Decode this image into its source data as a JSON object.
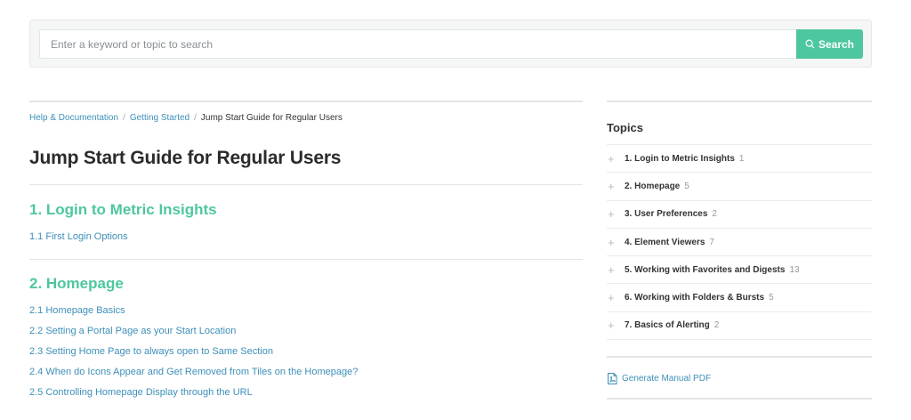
{
  "search": {
    "placeholder": "Enter a keyword or topic to search",
    "value": "",
    "button_label": "Search"
  },
  "breadcrumb": {
    "items": [
      "Help & Documentation",
      "Getting Started"
    ],
    "current": "Jump Start Guide for Regular Users",
    "separator": "/"
  },
  "page": {
    "title": "Jump Start Guide for Regular Users"
  },
  "sections": [
    {
      "title": "1. Login to Metric Insights",
      "items": [
        "1.1 First Login Options"
      ]
    },
    {
      "title": "2. Homepage",
      "items": [
        "2.1 Homepage Basics",
        "2.2 Setting a Portal Page as your Start Location",
        "2.3 Setting Home Page to always open to Same Section",
        "2.4 When do Icons Appear and Get Removed from Tiles on the Homepage?",
        "2.5 Controlling Homepage Display through the URL"
      ]
    }
  ],
  "sidebar": {
    "title": "Topics",
    "topics": [
      {
        "label": "1. Login to Metric Insights",
        "count": "1"
      },
      {
        "label": "2. Homepage",
        "count": "5"
      },
      {
        "label": "3. User Preferences",
        "count": "2"
      },
      {
        "label": "4. Element Viewers",
        "count": "7"
      },
      {
        "label": "5. Working with Favorites and Digests",
        "count": "13"
      },
      {
        "label": "6. Working with Folders & Bursts",
        "count": "5"
      },
      {
        "label": "7. Basics of Alerting",
        "count": "2"
      }
    ],
    "expand_glyph": "+",
    "pdf_label": "Generate Manual PDF"
  },
  "colors": {
    "accent": "#4dc7a0",
    "link": "#3d8fb8"
  },
  "icons": {
    "search": "search-icon",
    "expand": "plus-icon",
    "pdf": "pdf-file-icon"
  }
}
